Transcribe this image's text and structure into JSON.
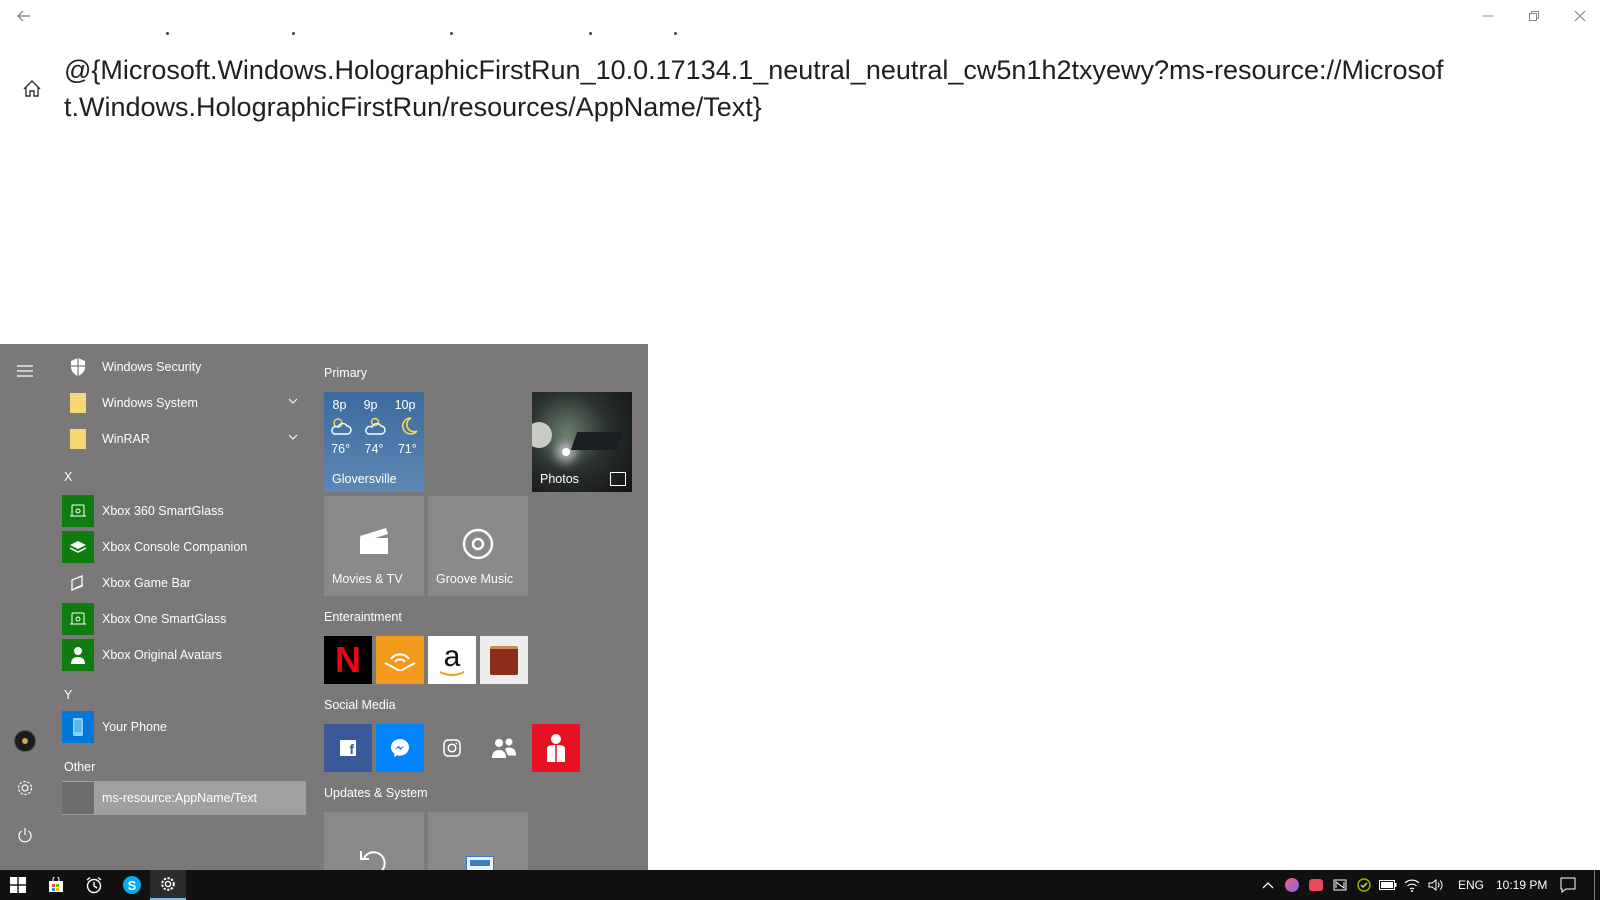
{
  "window": {
    "title": "@{Microsoft.Windows.HolographicFirstRun_10.0.17134.1_neutral_neutral_cw5n1h2txyewy?ms-resource://Microsoft.Windows.HolographicFirstRun/resources/AppName/Text}",
    "back_icon": "back-arrow-icon",
    "home_icon": "home-icon"
  },
  "start_menu": {
    "apps": [
      {
        "label": "Windows Security",
        "icon": "shield-icon",
        "icon_bg": "transparent"
      },
      {
        "label": "Windows System",
        "icon": "folder-icon",
        "icon_bg": "transparent",
        "expandable": true
      },
      {
        "label": "WinRAR",
        "icon": "folder-icon",
        "icon_bg": "transparent",
        "expandable": true
      },
      {
        "label": "Xbox 360 SmartGlass",
        "icon": "xbox-smartglass-icon",
        "icon_bg": "#107c10"
      },
      {
        "label": "Xbox Console Companion",
        "icon": "xbox-console-icon",
        "icon_bg": "#107c10"
      },
      {
        "label": "Xbox Game Bar",
        "icon": "xbox-gamebar-icon",
        "icon_bg": "transparent"
      },
      {
        "label": "Xbox One SmartGlass",
        "icon": "xbox-smartglass-icon",
        "icon_bg": "#107c10"
      },
      {
        "label": "Xbox Original Avatars",
        "icon": "avatar-icon",
        "icon_bg": "#107c10"
      },
      {
        "label": "Your Phone",
        "icon": "phone-icon",
        "icon_bg": "#0078d7"
      },
      {
        "label": "ms-resource:AppName/Text",
        "icon": "blank-app-icon",
        "icon_bg": "#6e6c6c",
        "selected": true
      }
    ],
    "letters": {
      "x": "X",
      "y": "Y",
      "other": "Other"
    },
    "groups": {
      "primary": "Primary",
      "entertainment": "Enteraintment",
      "social": "Social Media",
      "updates": "Updates & System"
    },
    "weather": {
      "times": [
        "8p",
        "9p",
        "10p"
      ],
      "temps": [
        "76°",
        "74°",
        "71°"
      ],
      "location": "Gloversville"
    },
    "tiles": {
      "photos": "Photos",
      "movies": "Movies & TV",
      "groove": "Groove Music"
    },
    "entertainment_tiles": [
      {
        "name": "netflix",
        "glyph": "N",
        "bg": "#000000",
        "fg": "#e50914"
      },
      {
        "name": "audible",
        "glyph": "",
        "bg": "#f39a1d",
        "fg": "#ffffff"
      },
      {
        "name": "amazon",
        "glyph": "a",
        "bg": "#ffffff",
        "fg": "#111111"
      },
      {
        "name": "bible",
        "glyph": "",
        "bg": "#eeeeee",
        "fg": "#8b2d1a"
      }
    ],
    "social_tiles": [
      {
        "name": "facebook",
        "glyph": "f",
        "bg": "#3b5998"
      },
      {
        "name": "messenger",
        "glyph": "",
        "bg": "#0084ff"
      },
      {
        "name": "instagram",
        "glyph": "",
        "bg": "transparent"
      },
      {
        "name": "people",
        "glyph": "",
        "bg": "transparent"
      },
      {
        "name": "avatar-app",
        "glyph": "",
        "bg": "#e81123"
      }
    ]
  },
  "taskbar": {
    "language": "ENG",
    "time": "10:19 PM"
  },
  "colors": {
    "start_bg": "#7a7878",
    "taskbar_bg": "#101010",
    "tile_bg": "#8a8888",
    "weather_bg": "#3e6aa1"
  }
}
